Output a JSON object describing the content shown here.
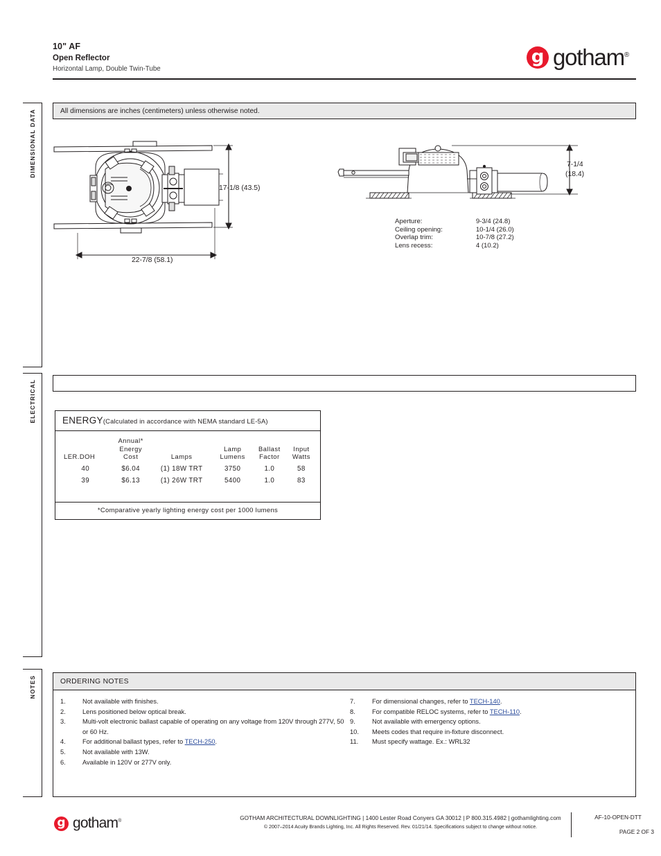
{
  "header": {
    "title": "10\" AF",
    "subtitle": "Open Reflector",
    "description": "Horizontal Lamp, Double Twin-Tube",
    "logo": {
      "mark": "g",
      "word": "gotham",
      "registered": "®",
      "brand_color": "#e8192c"
    }
  },
  "sidetabs": {
    "dimensional": "DIMENSIONAL  DATA",
    "electrical": "ELECTRICAL",
    "notes": "NOTES"
  },
  "banners": {
    "dimensional": "All dimensions are inches (centimeters) unless otherwise noted.",
    "electrical": ""
  },
  "drawings": {
    "top_view": {
      "name": "top-view-fixture-drawing",
      "height_dim": "17-1/8 (43.5)",
      "width_dim": "22-7/8 (58.1)"
    },
    "side_view": {
      "name": "side-view-fixture-drawing",
      "height_dim_line1": "7-1/4",
      "height_dim_line2": "(18.4)"
    }
  },
  "specs": {
    "rows": [
      {
        "label": "Aperture:",
        "value": "9-3/4 (24.8)"
      },
      {
        "label": "Ceiling opening:",
        "value": "10-1/4 (26.0)"
      },
      {
        "label": "Overlap trim:",
        "value": "10-7/8 (27.2)"
      },
      {
        "label": "Lens recess:",
        "value": "4 (10.2)"
      }
    ]
  },
  "energy": {
    "title": "ENERGY",
    "title_note": "(Calculated in accordance with NEMA standard  LE-5A)",
    "footnote": "*Comparative yearly lighting energy cost per 1000 lumens",
    "columns": [
      {
        "line1": "",
        "line2": "",
        "line3": "LER.DOH"
      },
      {
        "line1": "Annual*",
        "line2": "Energy",
        "line3": "Cost"
      },
      {
        "line1": "",
        "line2": "",
        "line3": "Lamps"
      },
      {
        "line1": "",
        "line2": "Lamp",
        "line3": "Lumens"
      },
      {
        "line1": "",
        "line2": "Ballast",
        "line3": "Factor"
      },
      {
        "line1": "",
        "line2": "Input",
        "line3": "Watts"
      }
    ],
    "rows": [
      {
        "ler_doh": "40",
        "cost": "$6.04",
        "lamps": "(1) 18W TRT",
        "lumens": "3750",
        "ballast": "1.0",
        "watts": "58"
      },
      {
        "ler_doh": "39",
        "cost": "$6.13",
        "lamps": "(1) 26W TRT",
        "lumens": "5400",
        "ballast": "1.0",
        "watts": "83"
      }
    ]
  },
  "ordering_notes": {
    "heading": "ORDERING NOTES",
    "left": [
      {
        "num": "1.",
        "parts": [
          {
            "t": "Not available with finishes."
          }
        ]
      },
      {
        "num": "2.",
        "parts": [
          {
            "t": "Lens positioned below optical break."
          }
        ]
      },
      {
        "num": "3.",
        "parts": [
          {
            "t": "Multi-volt electronic ballast capable of operating on any voltage from 120V through 277V, 50 or 60 Hz."
          }
        ]
      },
      {
        "num": "4.",
        "parts": [
          {
            "t": "For additional ballast types, refer to "
          },
          {
            "t": "TECH-250",
            "link": true
          },
          {
            "t": "."
          }
        ]
      },
      {
        "num": "5.",
        "parts": [
          {
            "t": "Not available with 13W."
          }
        ]
      },
      {
        "num": "6.",
        "parts": [
          {
            "t": "Available in 120V or 277V only."
          }
        ]
      }
    ],
    "right": [
      {
        "num": "7.",
        "parts": [
          {
            "t": "For dimensional changes, refer to "
          },
          {
            "t": "TECH-140",
            "link": true
          },
          {
            "t": "."
          }
        ]
      },
      {
        "num": "8.",
        "parts": [
          {
            "t": "For compatible RELOC systems, refer to "
          },
          {
            "t": "TECH-110",
            "link": true
          },
          {
            "t": "."
          }
        ]
      },
      {
        "num": "9.",
        "parts": [
          {
            "t": "Not available with emergency options."
          }
        ]
      },
      {
        "num": "10.",
        "parts": [
          {
            "t": "Meets codes that require in-fixture disconnect."
          }
        ]
      },
      {
        "num": "11.",
        "parts": [
          {
            "t": "Must specify wattage. Ex.: WRL32"
          }
        ]
      }
    ]
  },
  "footer": {
    "line1": "GOTHAM ARCHITECTURAL DOWNLIGHTING  |  1400 Lester Road Conyers GA 30012  |  P 800.315.4982  |  gothamlighting.com",
    "line2": "© 2007–2014 Acuity Brands Lighting, Inc. All Rights Reserved. Rev. 01/21/14. Specifications subject to change without notice.",
    "code": "AF-10-OPEN-DTT",
    "page": "PAGE 2 OF 3"
  }
}
